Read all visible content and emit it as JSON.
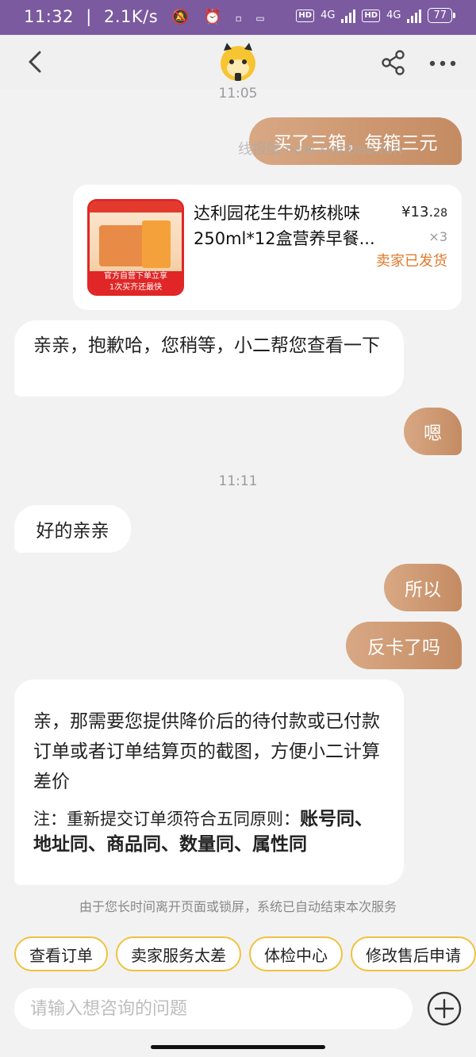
{
  "status_bar": {
    "time": "11:32",
    "speed": "2.1K/s",
    "network_label": "4G",
    "hd_label": "HD",
    "battery": "77"
  },
  "chat": {
    "time_1": "11:05",
    "msg_1": "买了三箱，每箱三元",
    "watermark": "线报酷 new.xianbao.fun",
    "product": {
      "title": "达利园花生牛奶核桃味250ml*12盒营养早餐...",
      "price_main": "¥13.",
      "price_cents": "28",
      "quantity": "×3",
      "status": "卖家已发货",
      "image_banner_1": "官方自营下单立享",
      "image_banner_2": "1次买齐还最快"
    },
    "msg_2": "亲亲，抱歉哈，您稍等，小二帮您查看一下",
    "msg_3": "嗯",
    "time_2": "11:11",
    "msg_4": "好的亲亲",
    "msg_5": "所以",
    "msg_6": "反卡了吗",
    "msg_7_line1": "亲，那需要您提供降价后的待付款或已付款订单或者订单结算页的截图，方便小二计算差价",
    "msg_7_note_prefix": "注：重新提交订单须符合五同原则：",
    "msg_7_note_bold": "账号同、地址同、商品同、数量同、属性同"
  },
  "notice": "由于您长时间离开页面或锁屏，系统已自动结束本次服务",
  "quick_replies": [
    "查看订单",
    "卖家服务太差",
    "体检中心",
    "修改售后申请"
  ],
  "input": {
    "placeholder": "请输入想咨询的问题"
  },
  "colors": {
    "status_bar": "#7b5aa0",
    "bubble_right": "#c48b62",
    "chip_border": "#f0c23e",
    "accent_orange": "#e07a2b"
  },
  "icons": [
    "back-icon",
    "assistant-logo-icon",
    "share-icon",
    "more-icon",
    "plus-icon"
  ]
}
